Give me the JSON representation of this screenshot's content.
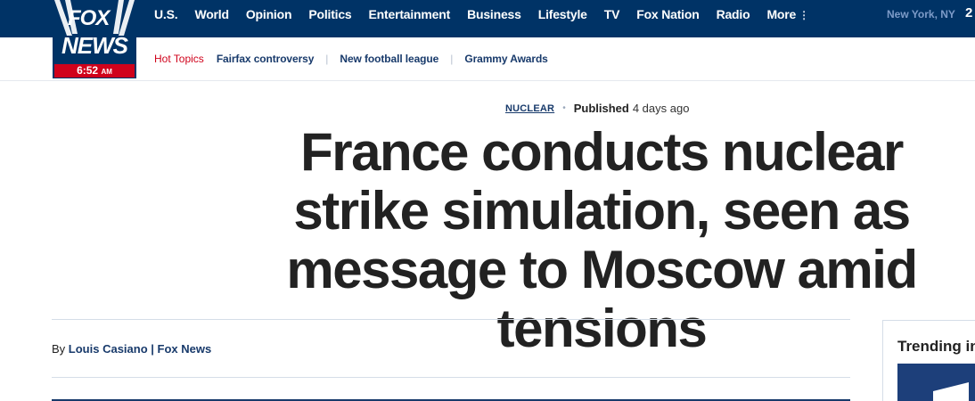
{
  "logo": {
    "line1": "FOX",
    "line2": "NEWS",
    "time": "6:52",
    "ampm": "AM"
  },
  "nav": {
    "items": [
      {
        "label": "U.S."
      },
      {
        "label": "World"
      },
      {
        "label": "Opinion"
      },
      {
        "label": "Politics"
      },
      {
        "label": "Entertainment"
      },
      {
        "label": "Business"
      },
      {
        "label": "Lifestyle"
      },
      {
        "label": "TV"
      },
      {
        "label": "Fox Nation"
      },
      {
        "label": "Radio"
      }
    ],
    "more_label": "More",
    "more_icon": "⋮",
    "location": "New York, NY",
    "temperature": "2"
  },
  "hot_topics": {
    "label": "Hot Topics",
    "items": [
      {
        "label": "Fairfax controversy"
      },
      {
        "label": "New football league"
      },
      {
        "label": "Grammy Awards"
      }
    ]
  },
  "article": {
    "category": "NUCLEAR",
    "published_label": "Published",
    "published_ago": "4 days ago",
    "headline": "France conducts nuclear strike simulation, seen as message to Moscow amid tensions",
    "byline_prefix": "By",
    "author": "Louis Casiano",
    "separator": "|",
    "outlet": "Fox News"
  },
  "trending": {
    "title": "Trending in"
  },
  "colors": {
    "brand_navy": "#003366",
    "accent_red": "#d0021b",
    "link_navy": "#183a6b"
  }
}
